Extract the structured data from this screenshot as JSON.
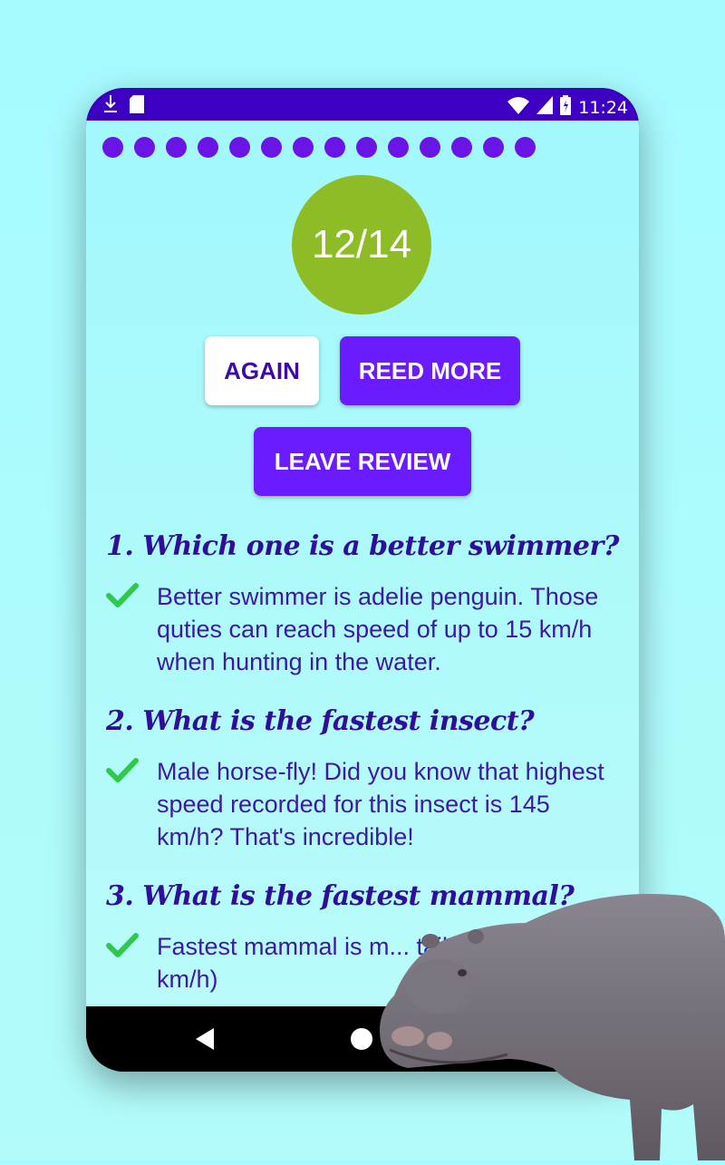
{
  "status_bar": {
    "time": "11:24"
  },
  "progress": {
    "total": 14,
    "color": "#6a14e6"
  },
  "score": {
    "text": "12/14",
    "color": "#8dbc26"
  },
  "buttons": {
    "again": "AGAIN",
    "read_more": "REED MORE",
    "leave_review": "LEAVE REVIEW"
  },
  "questions": [
    {
      "title": "1. Which one is a better swimmer?",
      "answer": "Better swimmer is adelie penguin. Those quties can reach speed of up to 15 km/h when hunting in the water.",
      "correct": true
    },
    {
      "title": "2. What is the fastest insect?",
      "answer": "Male horse-fly! Did you know that highest speed recorded for this insect is 145 km/h? That's incredible!",
      "correct": true
    },
    {
      "title": "3. What is the fastest mammal?",
      "answer": "Fastest mammal is m... tailed bat (160 km/h)",
      "correct": true
    }
  ],
  "colors": {
    "accent": "#6a1cff",
    "status_bar": "#3d00c2",
    "check": "#2ec94a",
    "text": "#3c1aa3"
  }
}
